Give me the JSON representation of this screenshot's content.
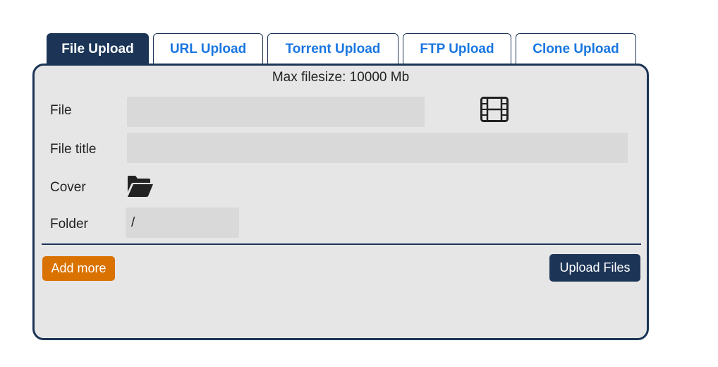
{
  "tabs": [
    {
      "label": "File Upload",
      "active": true
    },
    {
      "label": "URL Upload",
      "active": false
    },
    {
      "label": "Torrent Upload",
      "active": false
    },
    {
      "label": "FTP Upload",
      "active": false
    },
    {
      "label": "Clone Upload",
      "active": false
    }
  ],
  "panel": {
    "max_filesize": "Max filesize: 10000 Mb",
    "file_label": "File",
    "file_title_label": "File title",
    "cover_label": "Cover",
    "folder_label": "Folder",
    "file_value": "",
    "file_title_value": "",
    "folder_value": "/"
  },
  "icons": {
    "file_picker": "film-icon",
    "cover_picker": "folder-open-icon"
  },
  "buttons": {
    "add_more": "Add more",
    "upload_files": "Upload Files"
  },
  "colors": {
    "accent_navy": "#1c3557",
    "tab_link": "#1976e0",
    "add_more_orange": "#d97200",
    "panel_bg": "#e6e6e6",
    "field_bg": "#d9d9d9"
  }
}
